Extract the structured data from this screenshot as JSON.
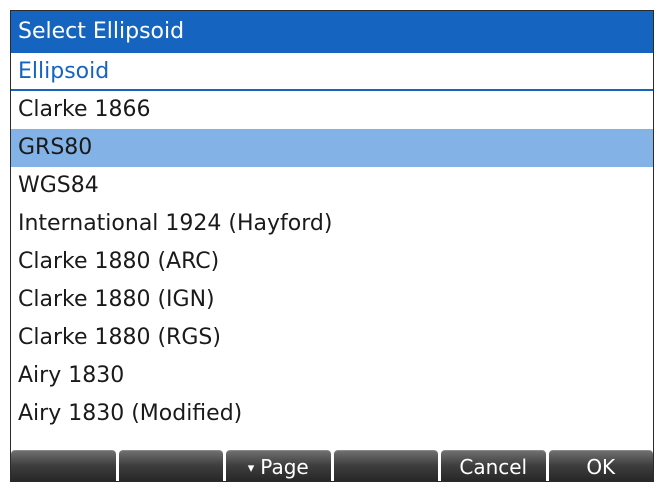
{
  "dialog": {
    "title": "Select Ellipsoid"
  },
  "list": {
    "header": "Ellipsoid",
    "selected_index": 1,
    "items": [
      "Clarke 1866",
      "GRS80",
      "WGS84",
      "International 1924 (Hayford)",
      "Clarke 1880 (ARC)",
      "Clarke 1880 (IGN)",
      "Clarke 1880 (RGS)",
      "Airy 1830",
      "Airy 1830 (Modified)"
    ]
  },
  "softkeys": {
    "key1": "",
    "key2": "",
    "page_arrow": "▾",
    "page": "Page",
    "key4": "",
    "cancel": "Cancel",
    "ok": "OK"
  },
  "colors": {
    "title_bg": "#1565c0",
    "header_text": "#1565c0",
    "selected_row": "#82b2e6",
    "softkey_bg": "#2e2e2e"
  },
  "icons": {
    "page_arrow": "page-down-arrow-icon"
  }
}
